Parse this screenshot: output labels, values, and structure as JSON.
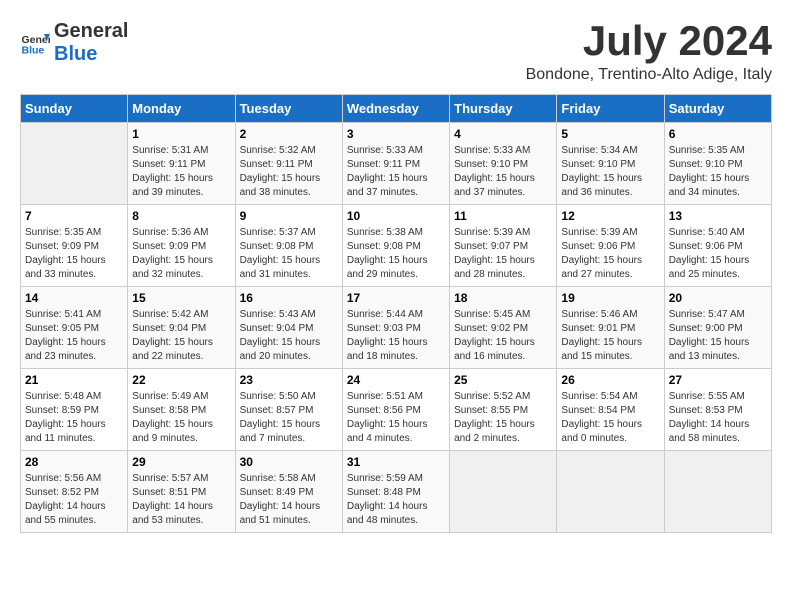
{
  "logo": {
    "text_general": "General",
    "text_blue": "Blue"
  },
  "title": {
    "month_year": "July 2024",
    "location": "Bondone, Trentino-Alto Adige, Italy"
  },
  "days_of_week": [
    "Sunday",
    "Monday",
    "Tuesday",
    "Wednesday",
    "Thursday",
    "Friday",
    "Saturday"
  ],
  "weeks": [
    {
      "days": [
        {
          "number": "",
          "info": ""
        },
        {
          "number": "1",
          "info": "Sunrise: 5:31 AM\nSunset: 9:11 PM\nDaylight: 15 hours\nand 39 minutes."
        },
        {
          "number": "2",
          "info": "Sunrise: 5:32 AM\nSunset: 9:11 PM\nDaylight: 15 hours\nand 38 minutes."
        },
        {
          "number": "3",
          "info": "Sunrise: 5:33 AM\nSunset: 9:11 PM\nDaylight: 15 hours\nand 37 minutes."
        },
        {
          "number": "4",
          "info": "Sunrise: 5:33 AM\nSunset: 9:10 PM\nDaylight: 15 hours\nand 37 minutes."
        },
        {
          "number": "5",
          "info": "Sunrise: 5:34 AM\nSunset: 9:10 PM\nDaylight: 15 hours\nand 36 minutes."
        },
        {
          "number": "6",
          "info": "Sunrise: 5:35 AM\nSunset: 9:10 PM\nDaylight: 15 hours\nand 34 minutes."
        }
      ]
    },
    {
      "days": [
        {
          "number": "7",
          "info": "Sunrise: 5:35 AM\nSunset: 9:09 PM\nDaylight: 15 hours\nand 33 minutes."
        },
        {
          "number": "8",
          "info": "Sunrise: 5:36 AM\nSunset: 9:09 PM\nDaylight: 15 hours\nand 32 minutes."
        },
        {
          "number": "9",
          "info": "Sunrise: 5:37 AM\nSunset: 9:08 PM\nDaylight: 15 hours\nand 31 minutes."
        },
        {
          "number": "10",
          "info": "Sunrise: 5:38 AM\nSunset: 9:08 PM\nDaylight: 15 hours\nand 29 minutes."
        },
        {
          "number": "11",
          "info": "Sunrise: 5:39 AM\nSunset: 9:07 PM\nDaylight: 15 hours\nand 28 minutes."
        },
        {
          "number": "12",
          "info": "Sunrise: 5:39 AM\nSunset: 9:06 PM\nDaylight: 15 hours\nand 27 minutes."
        },
        {
          "number": "13",
          "info": "Sunrise: 5:40 AM\nSunset: 9:06 PM\nDaylight: 15 hours\nand 25 minutes."
        }
      ]
    },
    {
      "days": [
        {
          "number": "14",
          "info": "Sunrise: 5:41 AM\nSunset: 9:05 PM\nDaylight: 15 hours\nand 23 minutes."
        },
        {
          "number": "15",
          "info": "Sunrise: 5:42 AM\nSunset: 9:04 PM\nDaylight: 15 hours\nand 22 minutes."
        },
        {
          "number": "16",
          "info": "Sunrise: 5:43 AM\nSunset: 9:04 PM\nDaylight: 15 hours\nand 20 minutes."
        },
        {
          "number": "17",
          "info": "Sunrise: 5:44 AM\nSunset: 9:03 PM\nDaylight: 15 hours\nand 18 minutes."
        },
        {
          "number": "18",
          "info": "Sunrise: 5:45 AM\nSunset: 9:02 PM\nDaylight: 15 hours\nand 16 minutes."
        },
        {
          "number": "19",
          "info": "Sunrise: 5:46 AM\nSunset: 9:01 PM\nDaylight: 15 hours\nand 15 minutes."
        },
        {
          "number": "20",
          "info": "Sunrise: 5:47 AM\nSunset: 9:00 PM\nDaylight: 15 hours\nand 13 minutes."
        }
      ]
    },
    {
      "days": [
        {
          "number": "21",
          "info": "Sunrise: 5:48 AM\nSunset: 8:59 PM\nDaylight: 15 hours\nand 11 minutes."
        },
        {
          "number": "22",
          "info": "Sunrise: 5:49 AM\nSunset: 8:58 PM\nDaylight: 15 hours\nand 9 minutes."
        },
        {
          "number": "23",
          "info": "Sunrise: 5:50 AM\nSunset: 8:57 PM\nDaylight: 15 hours\nand 7 minutes."
        },
        {
          "number": "24",
          "info": "Sunrise: 5:51 AM\nSunset: 8:56 PM\nDaylight: 15 hours\nand 4 minutes."
        },
        {
          "number": "25",
          "info": "Sunrise: 5:52 AM\nSunset: 8:55 PM\nDaylight: 15 hours\nand 2 minutes."
        },
        {
          "number": "26",
          "info": "Sunrise: 5:54 AM\nSunset: 8:54 PM\nDaylight: 15 hours\nand 0 minutes."
        },
        {
          "number": "27",
          "info": "Sunrise: 5:55 AM\nSunset: 8:53 PM\nDaylight: 14 hours\nand 58 minutes."
        }
      ]
    },
    {
      "days": [
        {
          "number": "28",
          "info": "Sunrise: 5:56 AM\nSunset: 8:52 PM\nDaylight: 14 hours\nand 55 minutes."
        },
        {
          "number": "29",
          "info": "Sunrise: 5:57 AM\nSunset: 8:51 PM\nDaylight: 14 hours\nand 53 minutes."
        },
        {
          "number": "30",
          "info": "Sunrise: 5:58 AM\nSunset: 8:49 PM\nDaylight: 14 hours\nand 51 minutes."
        },
        {
          "number": "31",
          "info": "Sunrise: 5:59 AM\nSunset: 8:48 PM\nDaylight: 14 hours\nand 48 minutes."
        },
        {
          "number": "",
          "info": ""
        },
        {
          "number": "",
          "info": ""
        },
        {
          "number": "",
          "info": ""
        }
      ]
    }
  ]
}
